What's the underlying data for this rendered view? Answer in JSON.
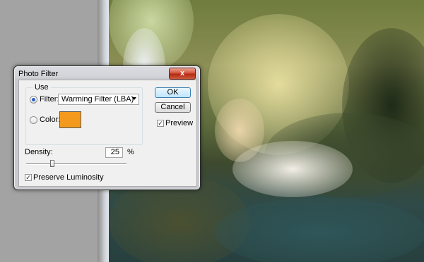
{
  "dialog": {
    "title": "Photo Filter",
    "close_label": "x",
    "use_group_label": "Use",
    "filter_option_label": "Filter:",
    "filter_selected": true,
    "filter_value": "Warming Filter (LBA)",
    "color_option_label": "Color:",
    "color_selected": false,
    "color_value": "#f39a1e",
    "ok_label": "OK",
    "cancel_label": "Cancel",
    "preview_label": "Preview",
    "preview_checked": true,
    "density_label": "Density:",
    "density_value": "25",
    "density_unit": "%",
    "density_fraction": 0.25,
    "preserve_label": "Preserve Luminosity",
    "preserve_checked": true
  },
  "icons": {
    "check_mark": "✓"
  }
}
